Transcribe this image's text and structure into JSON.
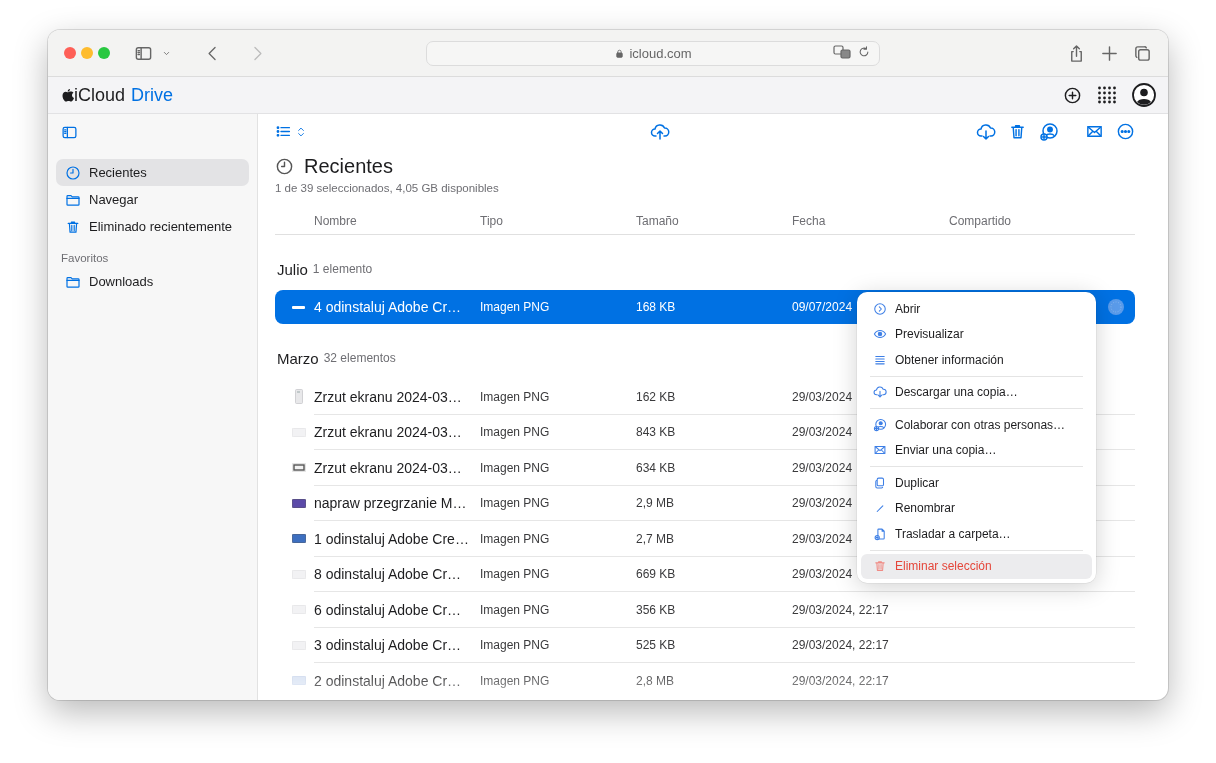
{
  "browser": {
    "url": "icloud.com"
  },
  "app": {
    "brand": "iCloud",
    "product": "Drive"
  },
  "sidebar": {
    "items": [
      {
        "label": "Recientes",
        "selected": true
      },
      {
        "label": "Navegar",
        "selected": false
      },
      {
        "label": "Eliminado recientemente",
        "selected": false
      }
    ],
    "favorites_heading": "Favoritos",
    "favorites": [
      {
        "label": "Downloads",
        "selected": false
      }
    ]
  },
  "main": {
    "title": "Recientes",
    "subtitle": "1 de 39 seleccionados, 4,05 GB disponibles",
    "columns": [
      "Nombre",
      "Tipo",
      "Tamaño",
      "Fecha",
      "Compartido"
    ],
    "groups": [
      {
        "name": "Julio",
        "count": "1 elemento",
        "rows": [
          {
            "name": "4 odinstaluj Adobe Cr…",
            "type": "Imagen PNG",
            "size": "168 KB",
            "date": "09/07/2024",
            "selected": true,
            "shared": true,
            "kind": "bar"
          }
        ]
      },
      {
        "name": "Marzo",
        "count": "32 elementos",
        "rows": [
          {
            "name": "Zrzut ekranu 2024-03…",
            "type": "Imagen PNG",
            "size": "162 KB",
            "date": "29/03/2024",
            "selected": false,
            "shared": false,
            "kind": "portrait"
          },
          {
            "name": "Zrzut ekranu 2024-03…",
            "type": "Imagen PNG",
            "size": "843 KB",
            "date": "29/03/2024",
            "selected": false,
            "shared": false,
            "kind": "light"
          },
          {
            "name": "Zrzut ekranu 2024-03…",
            "type": "Imagen PNG",
            "size": "634 KB",
            "date": "29/03/2024",
            "selected": false,
            "shared": false,
            "kind": "frame"
          },
          {
            "name": "napraw przegrzanie M…",
            "type": "Imagen PNG",
            "size": "2,9 MB",
            "date": "29/03/2024",
            "selected": false,
            "shared": false,
            "kind": "purple"
          },
          {
            "name": "1 odinstaluj Adobe Cre…",
            "type": "Imagen PNG",
            "size": "2,7 MB",
            "date": "29/03/2024",
            "selected": false,
            "shared": false,
            "kind": "blue"
          },
          {
            "name": "8 odinstaluj Adobe Cr…",
            "type": "Imagen PNG",
            "size": "669 KB",
            "date": "29/03/2024",
            "selected": false,
            "shared": false,
            "kind": "light"
          },
          {
            "name": "6 odinstaluj Adobe Cr…",
            "type": "Imagen PNG",
            "size": "356 KB",
            "date": "29/03/2024, 22:17",
            "selected": false,
            "shared": false,
            "kind": "light"
          },
          {
            "name": "3 odinstaluj Adobe Cr…",
            "type": "Imagen PNG",
            "size": "525 KB",
            "date": "29/03/2024, 22:17",
            "selected": false,
            "shared": false,
            "kind": "light"
          },
          {
            "name": "2 odinstaluj Adobe Cr…",
            "type": "Imagen PNG",
            "size": "2,8 MB",
            "date": "29/03/2024, 22:17",
            "selected": false,
            "shared": false,
            "kind": "pale"
          }
        ]
      }
    ]
  },
  "context_menu": {
    "sections": [
      [
        {
          "label": "Abrir",
          "highlighted": false,
          "destructive": false
        },
        {
          "label": "Previsualizar",
          "highlighted": false,
          "destructive": false
        },
        {
          "label": "Obtener información",
          "highlighted": false,
          "destructive": false
        }
      ],
      [
        {
          "label": "Descargar una copia…",
          "highlighted": false,
          "destructive": false
        }
      ],
      [
        {
          "label": "Colaborar con otras personas…",
          "highlighted": false,
          "destructive": false
        },
        {
          "label": "Enviar una copia…",
          "highlighted": false,
          "destructive": false
        }
      ],
      [
        {
          "label": "Duplicar",
          "highlighted": false,
          "destructive": false
        },
        {
          "label": "Renombrar",
          "highlighted": false,
          "destructive": false
        },
        {
          "label": "Trasladar a carpeta…",
          "highlighted": false,
          "destructive": false
        }
      ],
      [
        {
          "label": "Eliminar selección",
          "highlighted": true,
          "destructive": true
        }
      ]
    ]
  }
}
